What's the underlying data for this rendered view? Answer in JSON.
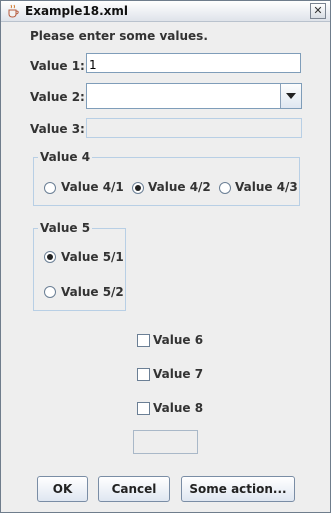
{
  "window": {
    "title": "Example18.xml",
    "close_symbol": "✕",
    "app_icon": "java-cup-icon",
    "close_icon": "close-icon"
  },
  "intro": {
    "text": "Please enter some values."
  },
  "fields": {
    "value1": {
      "label": "Value 1:",
      "value": "1"
    },
    "value2": {
      "label": "Value 2:",
      "value": ""
    },
    "value3": {
      "label": "Value 3:",
      "value": ""
    }
  },
  "group4": {
    "title": "Value 4",
    "options": [
      "Value 4/1",
      "Value 4/2",
      "Value 4/3"
    ],
    "selected": "Value 4/2"
  },
  "group5": {
    "title": "Value 5",
    "options": [
      "Value 5/1",
      "Value 5/2"
    ],
    "selected": "Value 5/1"
  },
  "checkboxes": [
    {
      "label": "Value 6",
      "checked": false
    },
    {
      "label": "Value 7",
      "checked": false
    },
    {
      "label": "Value 8",
      "checked": false
    }
  ],
  "buttons": {
    "ok": "OK",
    "cancel": "Cancel",
    "action": "Some action..."
  }
}
